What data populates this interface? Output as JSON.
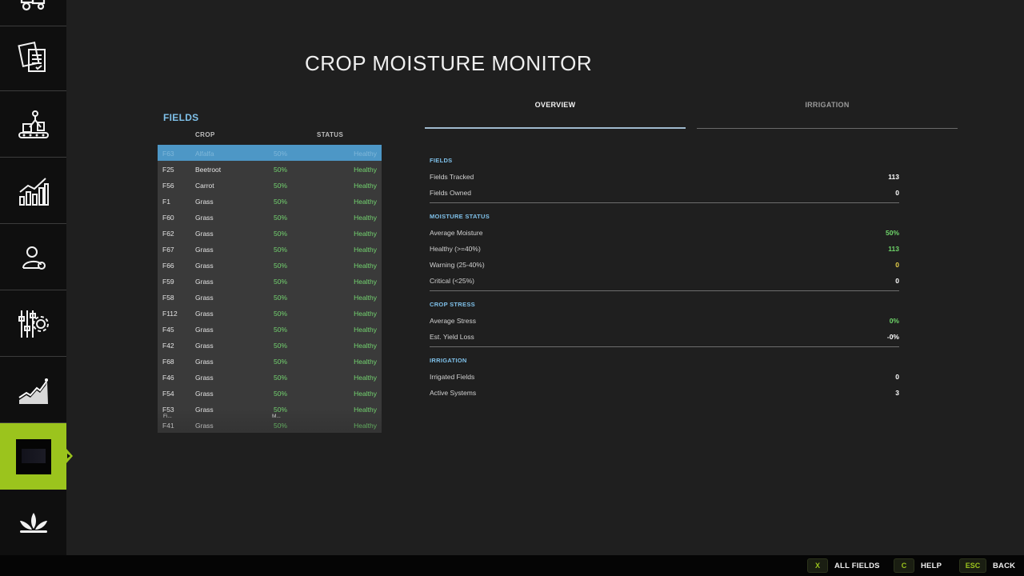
{
  "sidebar": {
    "items": [
      {
        "icon": "tractor-icon"
      },
      {
        "icon": "documents-icon"
      },
      {
        "icon": "production-icon"
      },
      {
        "icon": "statistics-icon"
      },
      {
        "icon": "farmer-finance-icon"
      },
      {
        "icon": "settings-gear-icon"
      },
      {
        "icon": "price-trend-icon"
      },
      {
        "icon": "crop-moisture-monitor-icon"
      },
      {
        "icon": "plant-icon"
      }
    ],
    "active_index": 7
  },
  "page": {
    "title": "CROP MOISTURE MONITOR"
  },
  "fields_panel": {
    "title": "FIELDS",
    "columns": {
      "crop": "CROP",
      "status": "STATUS"
    },
    "rows": [
      {
        "id": "F63",
        "crop": "Alfalfa",
        "moisture": "50%",
        "status": "Healthy",
        "selected": true
      },
      {
        "id": "F25",
        "crop": "Beetroot",
        "moisture": "50%",
        "status": "Healthy"
      },
      {
        "id": "F56",
        "crop": "Carrot",
        "moisture": "50%",
        "status": "Healthy"
      },
      {
        "id": "F1",
        "crop": "Grass",
        "moisture": "50%",
        "status": "Healthy"
      },
      {
        "id": "F60",
        "crop": "Grass",
        "moisture": "50%",
        "status": "Healthy"
      },
      {
        "id": "F62",
        "crop": "Grass",
        "moisture": "50%",
        "status": "Healthy"
      },
      {
        "id": "F67",
        "crop": "Grass",
        "moisture": "50%",
        "status": "Healthy"
      },
      {
        "id": "F66",
        "crop": "Grass",
        "moisture": "50%",
        "status": "Healthy"
      },
      {
        "id": "F59",
        "crop": "Grass",
        "moisture": "50%",
        "status": "Healthy"
      },
      {
        "id": "F58",
        "crop": "Grass",
        "moisture": "50%",
        "status": "Healthy"
      },
      {
        "id": "F112",
        "crop": "Grass",
        "moisture": "50%",
        "status": "Healthy"
      },
      {
        "id": "F45",
        "crop": "Grass",
        "moisture": "50%",
        "status": "Healthy"
      },
      {
        "id": "F42",
        "crop": "Grass",
        "moisture": "50%",
        "status": "Healthy"
      },
      {
        "id": "F68",
        "crop": "Grass",
        "moisture": "50%",
        "status": "Healthy"
      },
      {
        "id": "F46",
        "crop": "Grass",
        "moisture": "50%",
        "status": "Healthy"
      },
      {
        "id": "F54",
        "crop": "Grass",
        "moisture": "50%",
        "status": "Healthy"
      },
      {
        "id": "F53",
        "crop": "Grass",
        "moisture": "50%",
        "status": "Healthy"
      },
      {
        "id": "F41",
        "crop": "Grass",
        "moisture": "50%",
        "status": "Healthy"
      }
    ],
    "truncated_header": {
      "field": "Fi...",
      "moisture": "M..."
    }
  },
  "tabs": [
    {
      "label": "OVERVIEW",
      "active": true
    },
    {
      "label": "IRRIGATION",
      "active": false
    }
  ],
  "overview": {
    "fields": {
      "title": "FIELDS",
      "tracked_label": "Fields Tracked",
      "tracked_value": "113",
      "owned_label": "Fields Owned",
      "owned_value": "0"
    },
    "moisture_status": {
      "title": "MOISTURE STATUS",
      "avg_label": "Average Moisture",
      "avg_value": "50%",
      "healthy_label": "Healthy (>=40%)",
      "healthy_value": "113",
      "warning_label": "Warning (25-40%)",
      "warning_value": "0",
      "critical_label": "Critical (<25%)",
      "critical_value": "0"
    },
    "crop_stress": {
      "title": "CROP STRESS",
      "avg_stress_label": "Average Stress",
      "avg_stress_value": "0%",
      "yield_loss_label": "Est. Yield Loss",
      "yield_loss_value": "-0%"
    },
    "irrigation": {
      "title": "IRRIGATION",
      "irrigated_label": "Irrigated Fields",
      "irrigated_value": "0",
      "active_label": "Active Systems",
      "active_value": "3"
    }
  },
  "bottom_bar": {
    "hints": [
      {
        "key": "X",
        "action": "ALL FIELDS"
      },
      {
        "key": "C",
        "action": "HELP"
      },
      {
        "key": "ESC",
        "action": "BACK"
      }
    ]
  },
  "colors": {
    "accent_green": "#9bc41d",
    "section_blue": "#7fc1ea",
    "healthy_green": "#73d36f",
    "warning_yellow": "#e8d14a",
    "selected_row": "#4d97c6"
  }
}
